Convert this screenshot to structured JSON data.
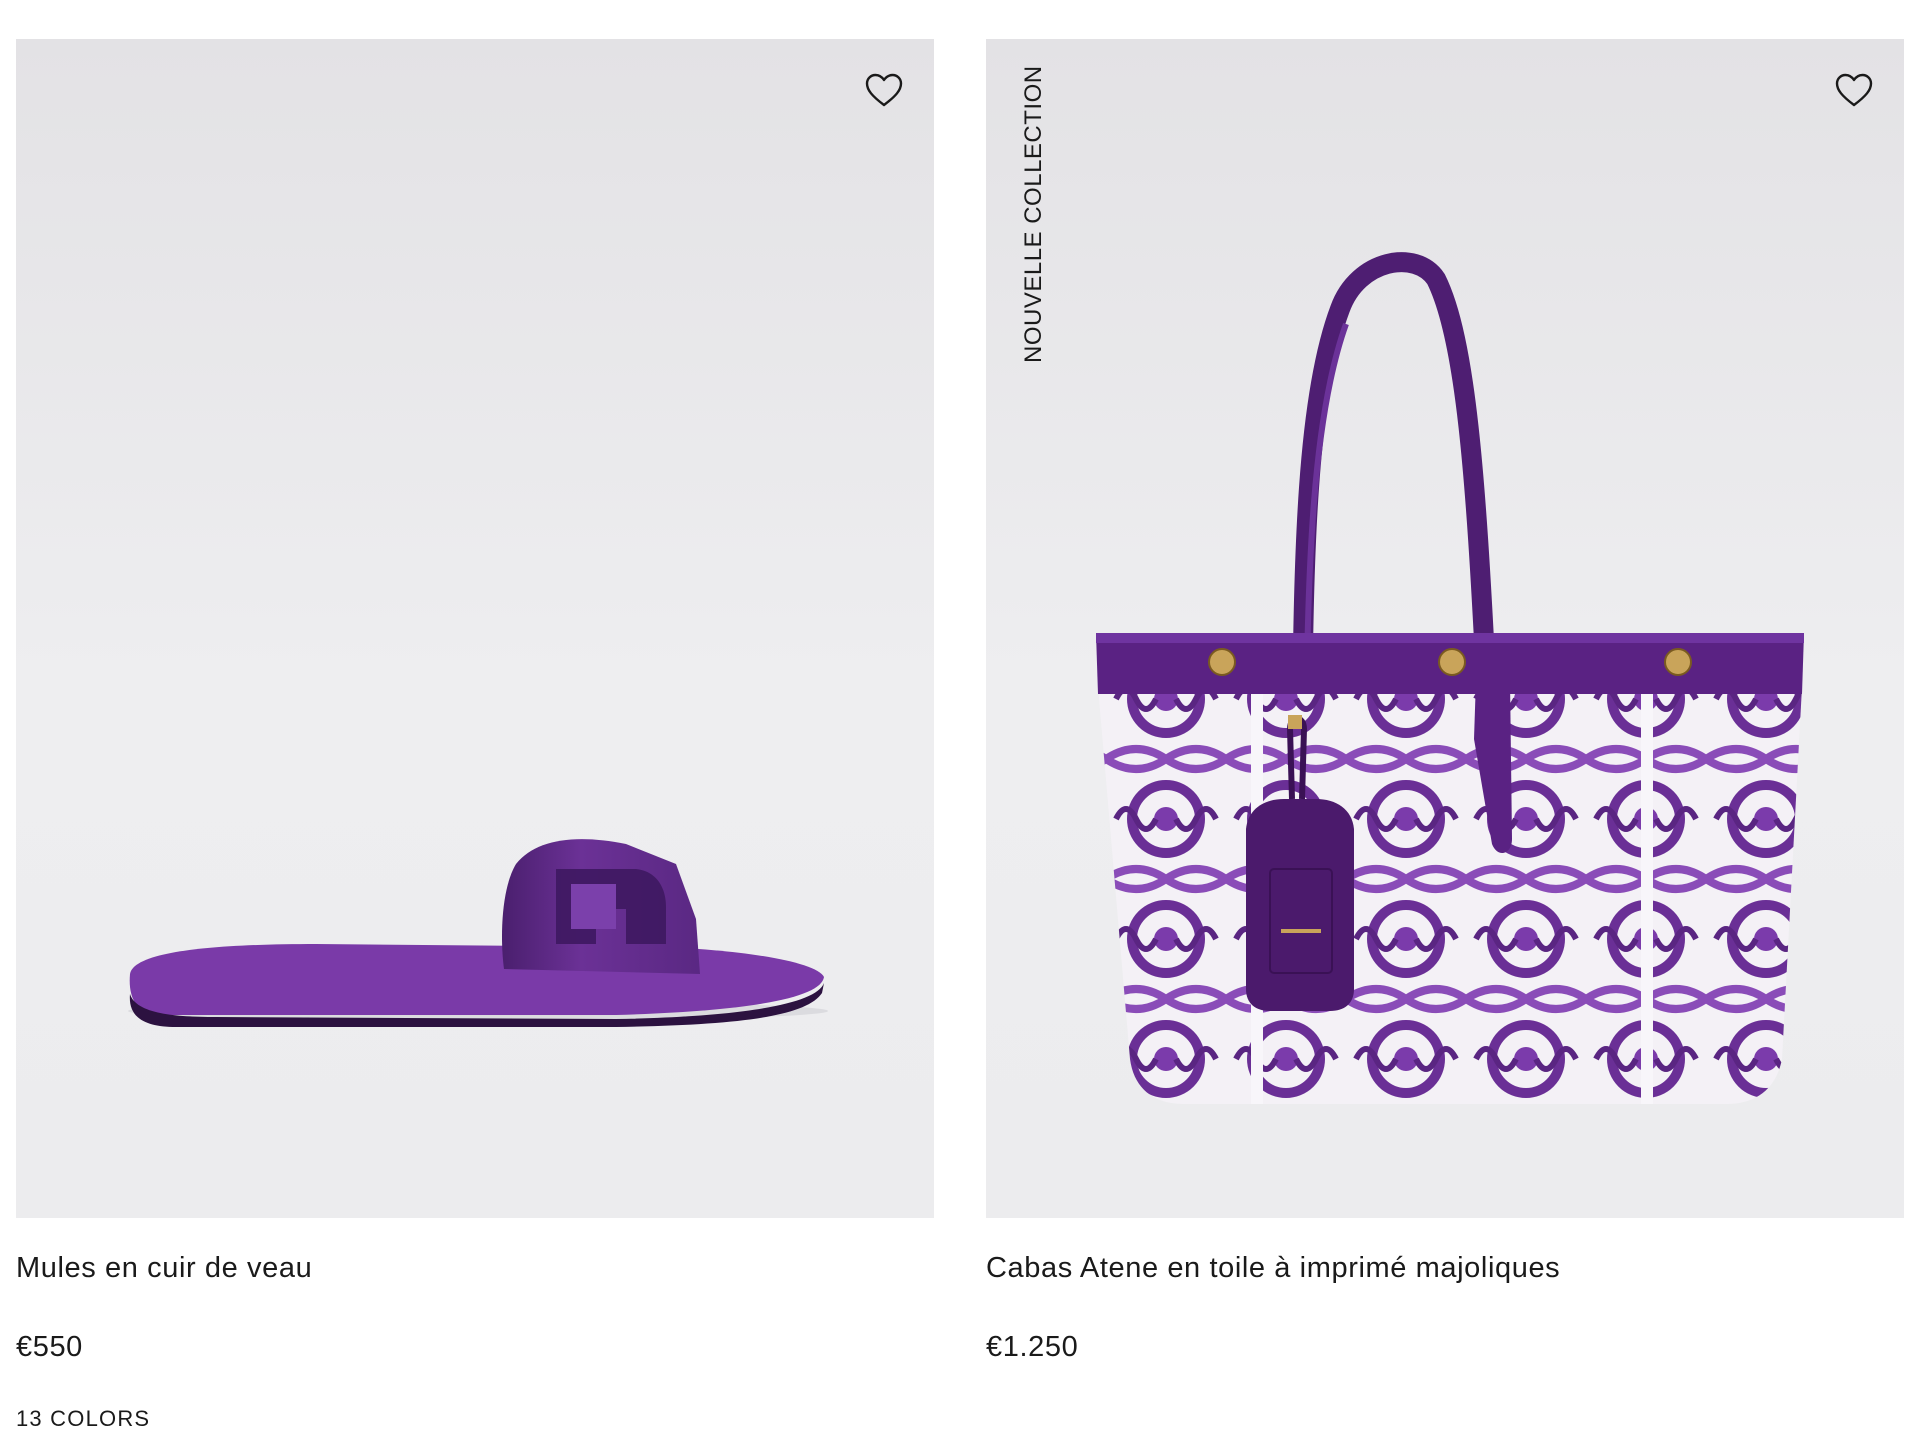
{
  "products": [
    {
      "name": "Mules en cuir de veau",
      "price": "€550",
      "colors_label": "13 COLORS",
      "badge": "",
      "wishlist_icon": "heart-outline-icon"
    },
    {
      "name": "Cabas Atene en toile à imprimé majoliques",
      "price": "€1.250",
      "colors_label": "",
      "badge": "NOUVELLE COLLECTION",
      "wishlist_icon": "heart-outline-icon"
    }
  ],
  "palette": {
    "image_bg": "#e6e6e9",
    "product_purple": "#5e2a86",
    "text": "#1a1a1a"
  }
}
